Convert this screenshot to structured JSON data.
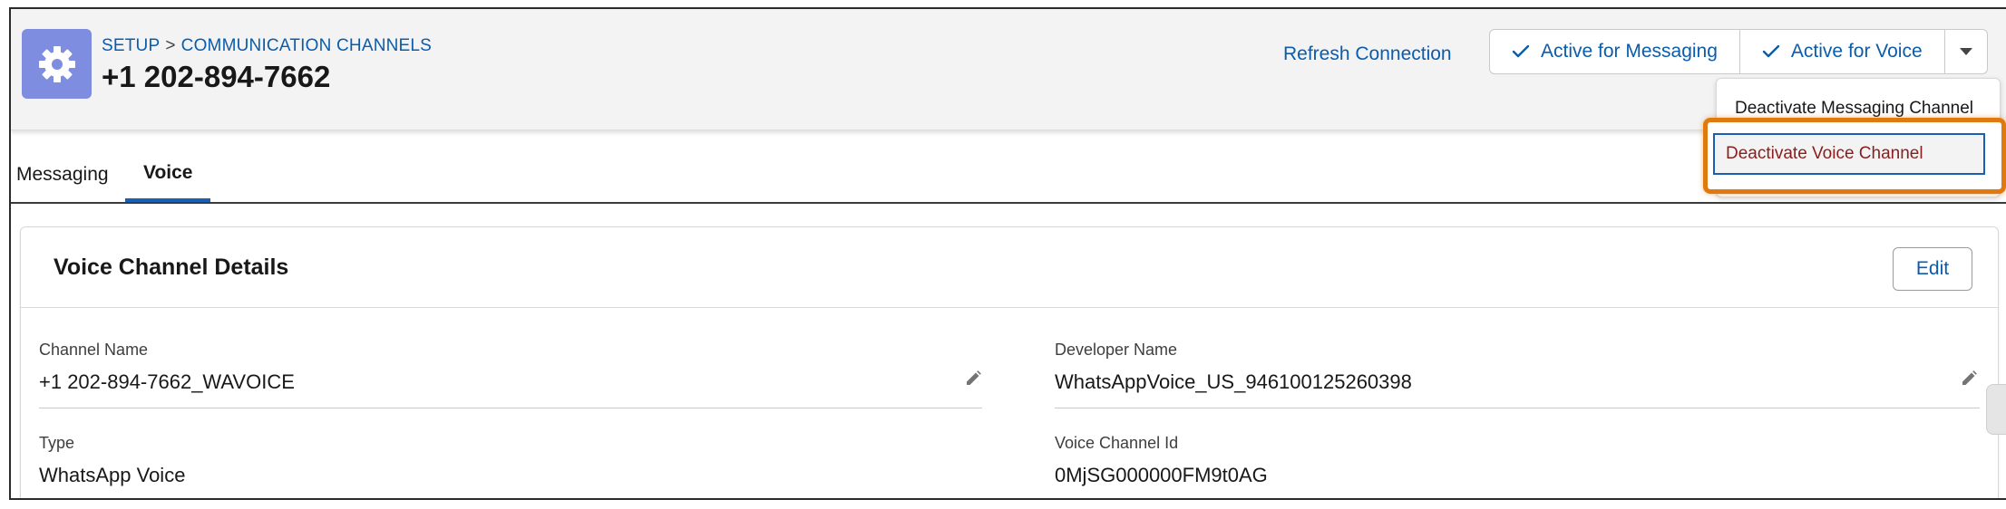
{
  "header": {
    "breadcrumb": {
      "setup": "SETUP",
      "separator": ">",
      "channels": "COMMUNICATION CHANNELS"
    },
    "title": "+1 202-894-7662",
    "refresh_label": "Refresh Connection",
    "buttons": {
      "messaging_label": "Active for Messaging",
      "voice_label": "Active for Voice"
    },
    "menu": {
      "deactivate_messaging": "Deactivate Messaging Channel",
      "deactivate_voice": "Deactivate Voice Channel"
    }
  },
  "tabs": [
    {
      "label": "Messaging",
      "active": false
    },
    {
      "label": "Voice",
      "active": true
    }
  ],
  "card": {
    "title": "Voice Channel Details",
    "edit_label": "Edit",
    "fields": {
      "channel_name": {
        "label": "Channel Name",
        "value": "+1 202-894-7662_WAVOICE"
      },
      "developer_name": {
        "label": "Developer Name",
        "value": "WhatsAppVoice_US_946100125260398"
      },
      "type": {
        "label": "Type",
        "value": "WhatsApp Voice"
      },
      "voice_channel_id": {
        "label": "Voice Channel Id",
        "value": "0MjSG000000FM9t0AG"
      }
    }
  },
  "colors": {
    "brand_blue": "#0b5cab",
    "gear_tile": "#7f8de1",
    "highlight": "#e07a0e",
    "destructive_text": "#8a1d1d"
  },
  "icons": [
    "gear-icon",
    "checkmark-icon",
    "chevron-down-icon",
    "pencil-icon"
  ]
}
